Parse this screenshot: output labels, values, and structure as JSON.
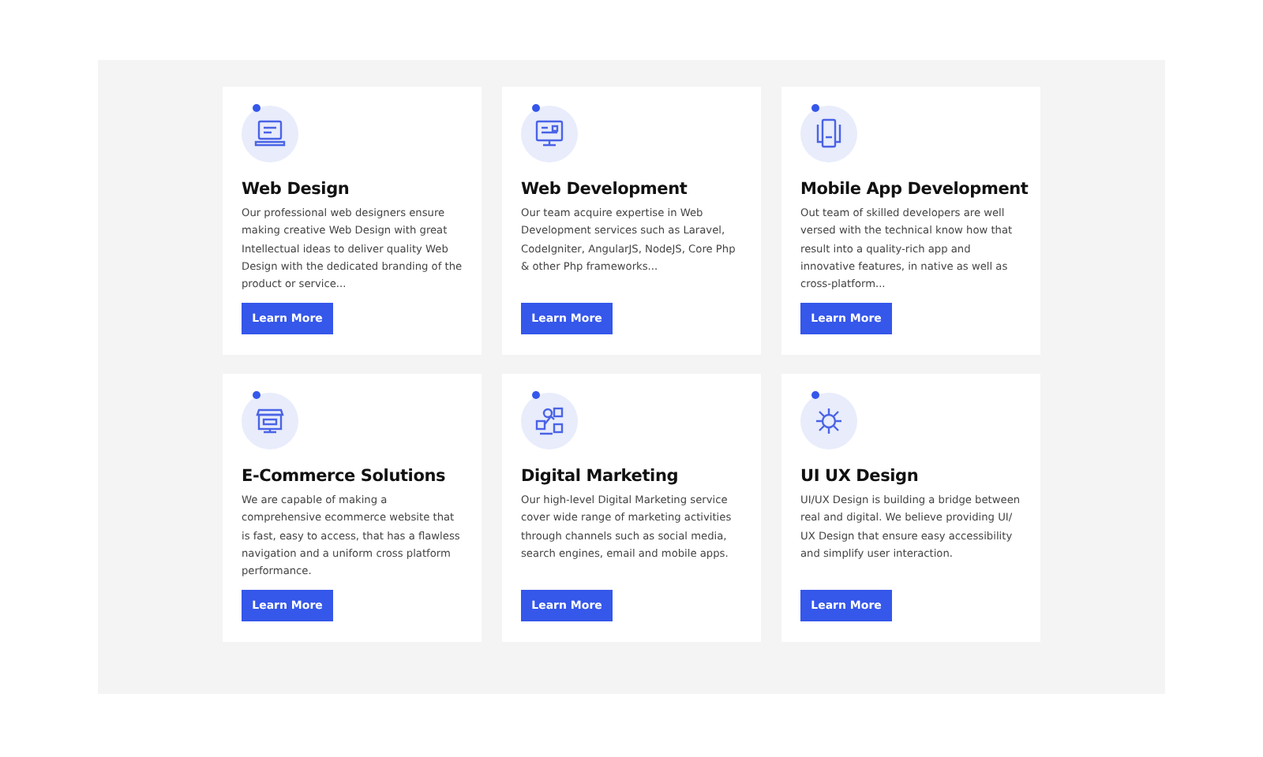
{
  "services": [
    {
      "title": "Web Design",
      "description": "Our professional web designers ensure making creative Web Design with great Intellectual ideas to deliver quality Web Design with the dedicated branding of the product or service...",
      "button": "Learn More"
    },
    {
      "title": "Web Development",
      "description": "Our team acquire expertise in Web Development services such as Laravel, CodeIgniter, AngularJS, NodeJS, Core Php & other Php frameworks...",
      "button": "Learn More"
    },
    {
      "title": "Mobile App Development",
      "description": "Out team of skilled developers are well versed with the technical know how that result into a quality-rich app and innovative features, in native as well as cross-platform...",
      "button": "Learn More"
    },
    {
      "title": "E-Commerce Solutions",
      "description": "We are capable of making a comprehensive ecommerce website that is fast, easy to access, that has a flawless navigation and a uniform cross platform performance.",
      "button": "Learn More"
    },
    {
      "title": "Digital Marketing",
      "description": "Our high-level Digital Marketing service cover wide range of marketing activities through channels such as social media, search engines, email and mobile apps.",
      "button": "Learn More"
    },
    {
      "title": "UI UX Design",
      "description": "UI/UX Design is building a bridge between real and digital. We believe providing UI/ UX Design that ensure easy accessibility and simplify user interaction.",
      "button": "Learn More"
    }
  ]
}
